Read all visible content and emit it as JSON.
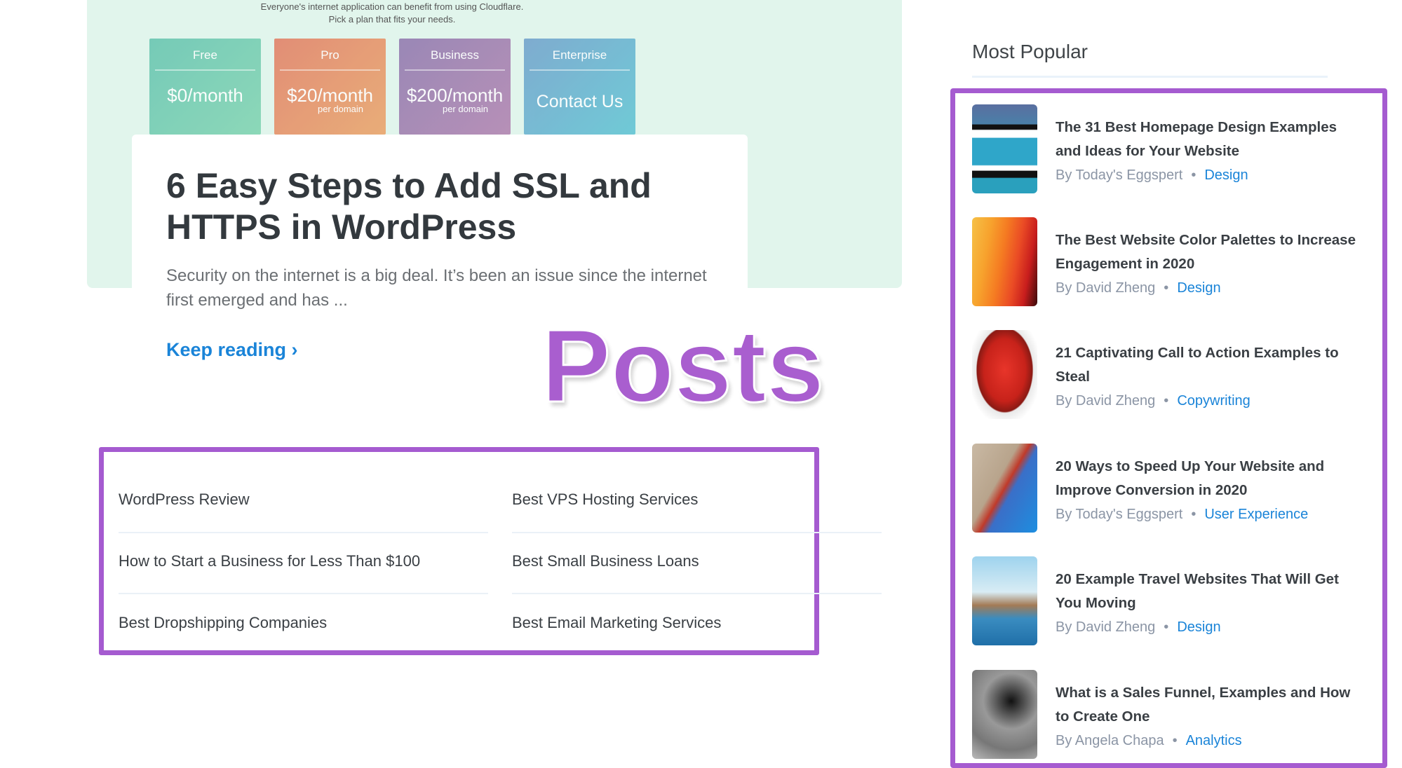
{
  "hero": {
    "tagline_top": "Everyone's internet application can benefit from using Cloudflare.",
    "tagline": "Pick a plan that fits your needs.",
    "plans": [
      {
        "name": "Free",
        "price": "$0/month",
        "sub": "",
        "color": "#6ccbb0"
      },
      {
        "name": "Pro",
        "price": "$20/month",
        "sub": "per domain",
        "color": "#e58a63"
      },
      {
        "name": "Business",
        "price": "$200/month",
        "sub": "per domain",
        "color": "#9478ad"
      },
      {
        "name": "Enterprise",
        "price": "Contact Us",
        "sub": "",
        "color": "#6cafcf"
      }
    ]
  },
  "article": {
    "title": "6 Easy Steps to Add SSL and HTTPS in WordPress",
    "excerpt": "Security on the internet is a big deal. It’s been an issue since the internet first emerged and has ...",
    "keep_reading": "Keep reading ›"
  },
  "annotation": {
    "label": "Posts",
    "color": "#a55bd0"
  },
  "links": [
    [
      "WordPress Review",
      "Best VPS Hosting Services"
    ],
    [
      "How to Start a Business for Less Than $100",
      "Best Small Business Loans"
    ],
    [
      "Best Dropshipping Companies",
      "Best Email Marketing Services"
    ]
  ],
  "sidebar": {
    "title": "Most Popular",
    "items": [
      {
        "title": "The 31 Best Homepage Design Examples and Ideas for Your Website",
        "author": "By Today's Eggspert",
        "category": "Design",
        "thumb": "homepage-screenshot"
      },
      {
        "title": "The Best Website Color Palettes to Increase Engagement in 2020",
        "author": "By David Zheng",
        "category": "Design",
        "thumb": "color-swatches"
      },
      {
        "title": "21 Captivating Call to Action Examples to Steal",
        "author": "By David Zheng",
        "category": "Copywriting",
        "thumb": "act-now-button"
      },
      {
        "title": "20 Ways to Speed Up Your Website and Improve Conversion in 2020",
        "author": "By Today's Eggspert",
        "category": "User Experience",
        "thumb": "roller-coaster"
      },
      {
        "title": "20 Example Travel Websites That Will Get You Moving",
        "author": "By David Zheng",
        "category": "Design",
        "thumb": "world-landmarks"
      },
      {
        "title": "What is a Sales Funnel, Examples and How to Create One",
        "author": "By Angela Chapa",
        "category": "Analytics",
        "thumb": "money-funnel"
      }
    ]
  },
  "colors": {
    "accent": "#1a84d8",
    "highlight": "#a55bd0",
    "hero_bg": "#e1f5ec"
  }
}
